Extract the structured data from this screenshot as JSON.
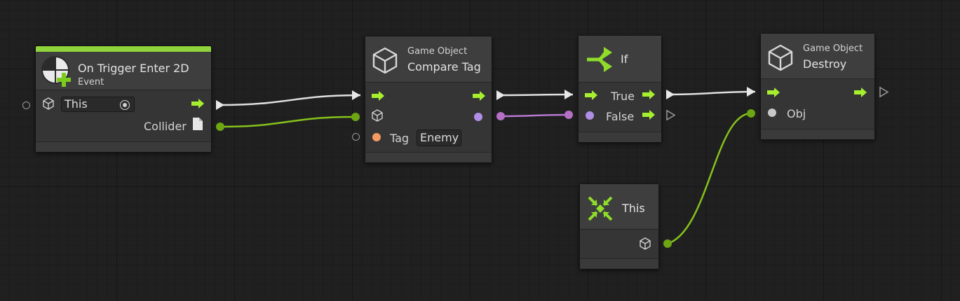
{
  "nodes": {
    "on_trigger": {
      "title": "On Trigger Enter 2D",
      "subtitle": "Event",
      "target_value": "This",
      "collider_label": "Collider"
    },
    "compare_tag": {
      "category": "Game Object",
      "title": "Compare Tag",
      "tag_label": "Tag",
      "tag_value": "Enemy"
    },
    "if_node": {
      "title": "If",
      "true_label": "True",
      "false_label": "False"
    },
    "destroy": {
      "category": "Game Object",
      "title": "Destroy",
      "obj_label": "Obj"
    },
    "this_node": {
      "title": "This"
    }
  },
  "colors": {
    "flow_arrow": "#a6ef2f",
    "object_port": "#8fc71f",
    "string_port": "#f59a60",
    "bool_port": "#b18ee6",
    "event_header_bar": "#8fd43a",
    "wire_flow": "#e0e0e0",
    "wire_object": "#86c21c",
    "wire_bool": "#b878d0"
  },
  "icons": [
    "trigger-event-icon",
    "cube-icon",
    "branch-icon",
    "self-arrows-icon",
    "file-icon",
    "flow-arrow-icon",
    "target-icon"
  ]
}
